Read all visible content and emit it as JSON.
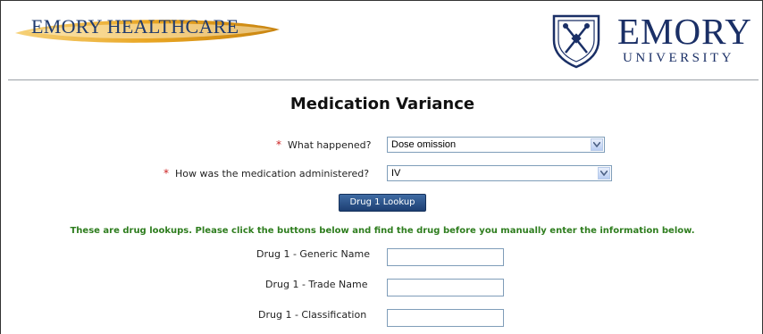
{
  "header": {
    "left_logo_text": "EMORY HEALTHCARE",
    "right_logo_word": "EMORY",
    "right_logo_sub": "UNIVERSITY"
  },
  "page_title": "Medication Variance",
  "form": {
    "required_mark": "*",
    "what_happened": {
      "label": "What happened?",
      "value": "Dose omission"
    },
    "administered": {
      "label": "How was the medication administered?",
      "value": "IV"
    },
    "lookup_button": "Drug 1 Lookup",
    "instructions": "These are drug lookups. Please click the buttons below and find the drug before you manually enter the information below.",
    "generic_name": {
      "label": "Drug 1 - Generic Name",
      "value": ""
    },
    "trade_name": {
      "label": "Drug 1 - Trade Name",
      "value": ""
    },
    "classification": {
      "label": "Drug 1 - Classification",
      "value": ""
    }
  },
  "colors": {
    "brand_navy": "#1a2f66",
    "healthcare_gold": "#e9a623",
    "instruction_green": "#2e7d1e",
    "required_red": "#cc2222"
  }
}
